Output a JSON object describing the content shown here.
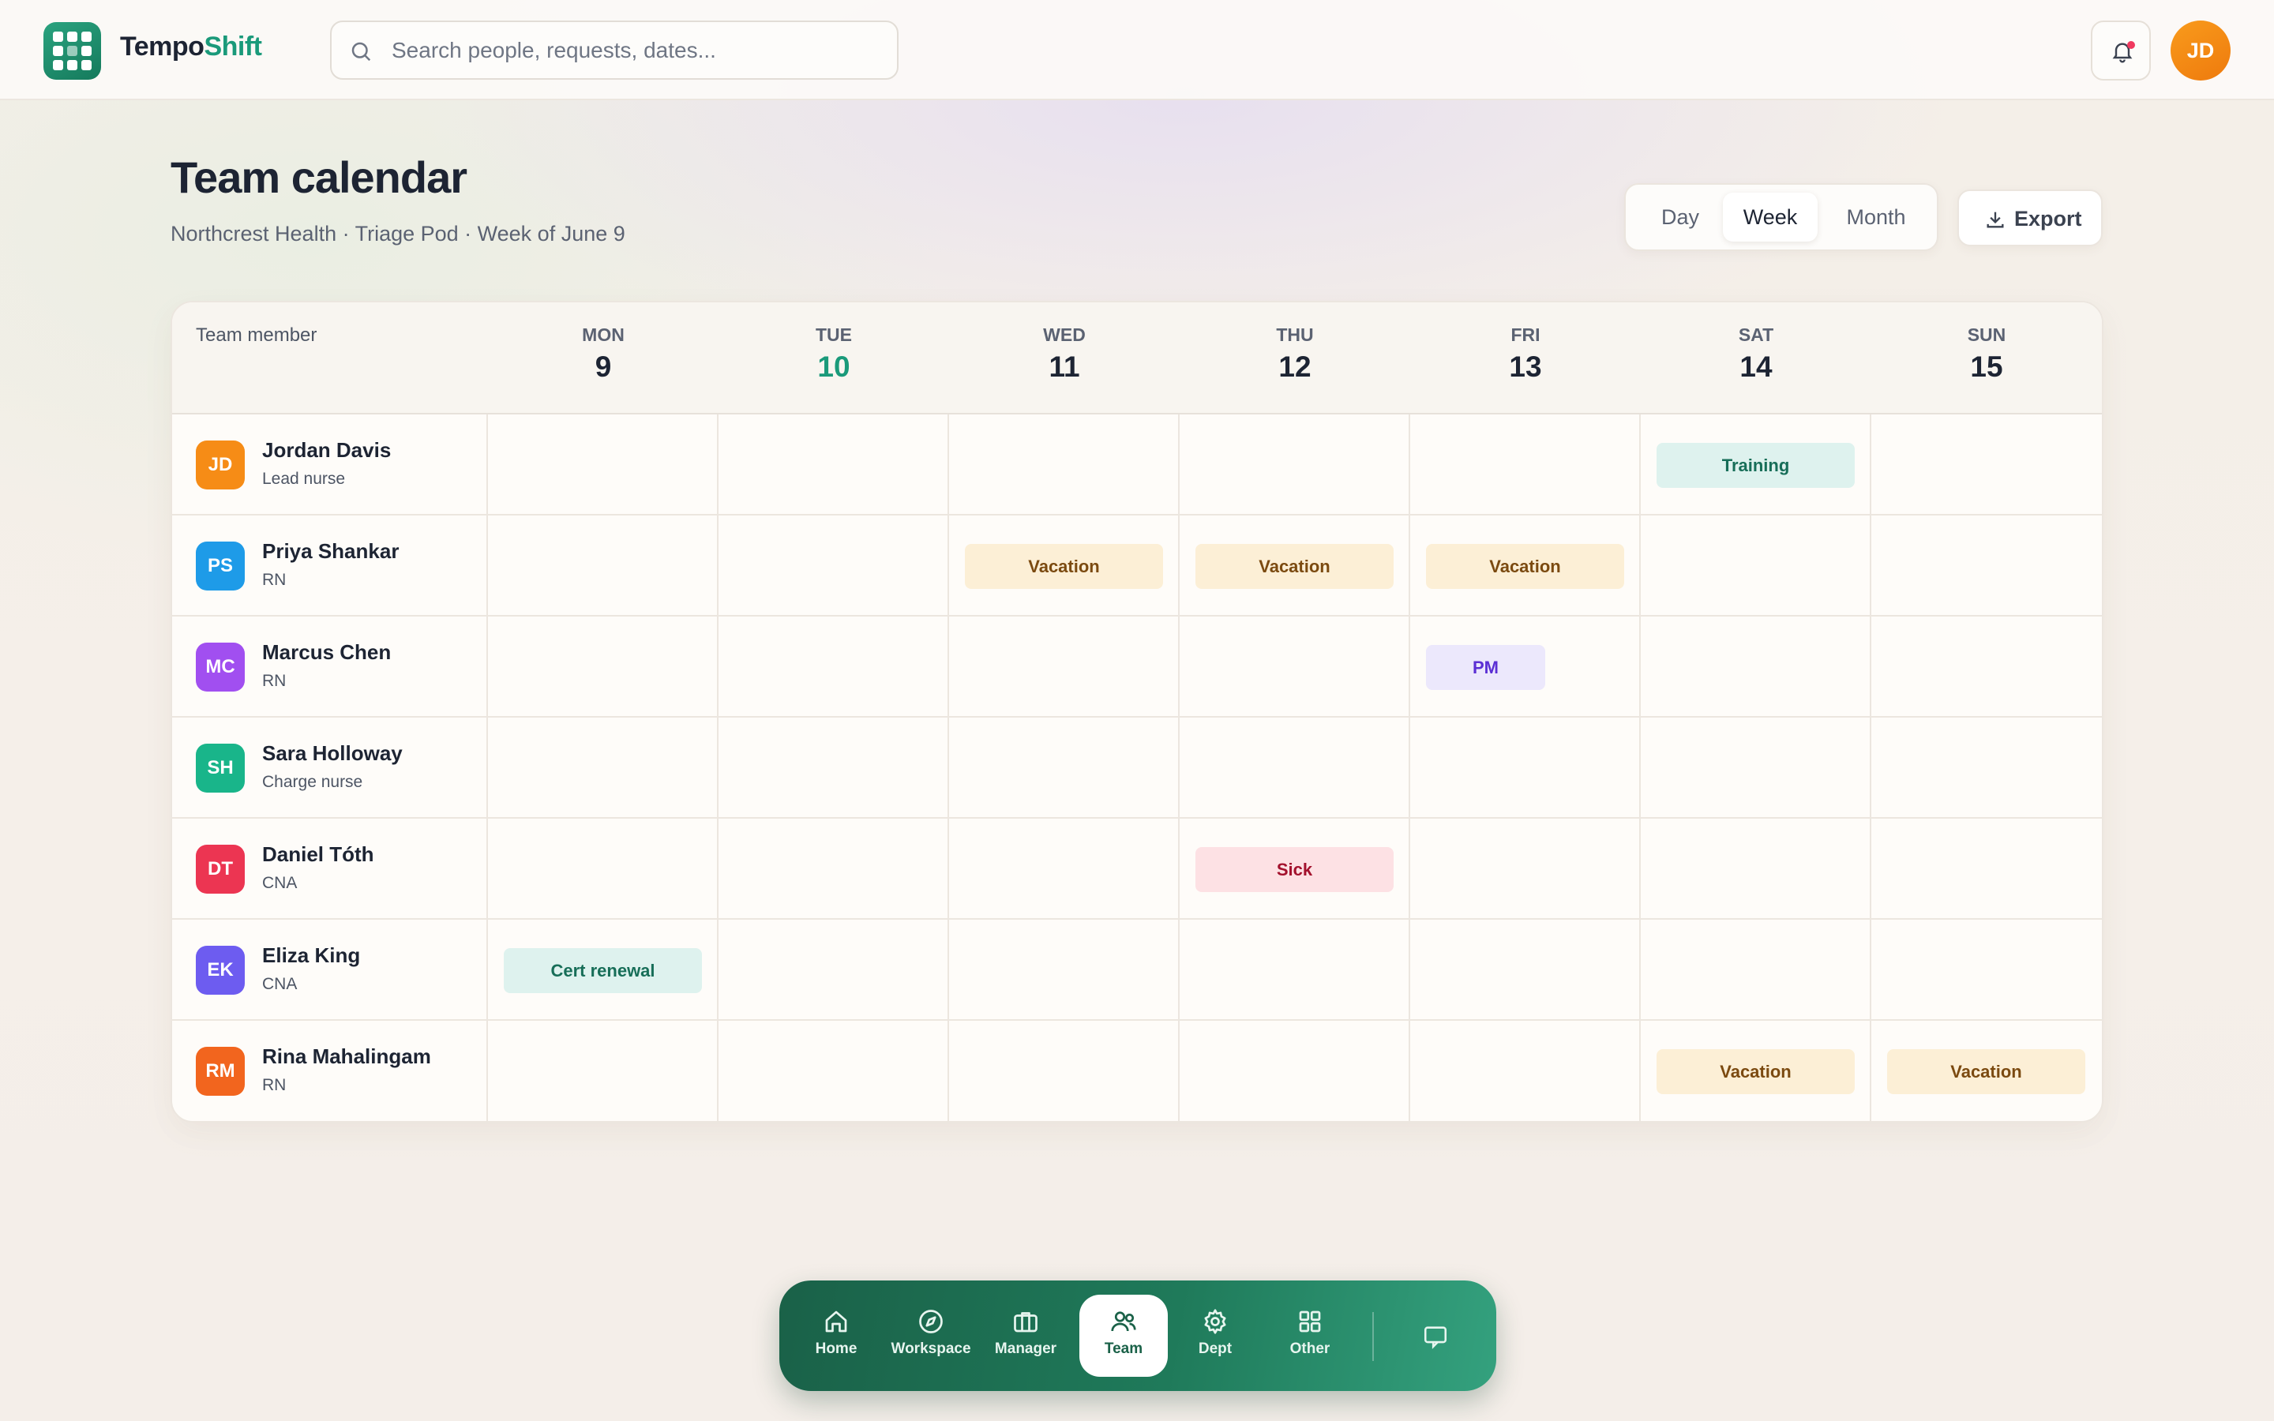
{
  "app": {
    "brand_part1": "Tempo",
    "brand_part2": "Shift",
    "user_initials": "JD",
    "accent_color": "#1a9a7a"
  },
  "search": {
    "placeholder": "Search people, requests, dates..."
  },
  "header": {
    "title": "Team calendar",
    "subtitle": "Northcrest Health · Triage Pod · Week of June 9"
  },
  "view_toggle": {
    "options": [
      "Day",
      "Week",
      "Month"
    ],
    "selected": "Week"
  },
  "export_label": "Export",
  "calendar": {
    "member_column_label": "Team member",
    "days": [
      {
        "name": "MON",
        "num": "9"
      },
      {
        "name": "TUE",
        "num": "10",
        "today": true
      },
      {
        "name": "WED",
        "num": "11"
      },
      {
        "name": "THU",
        "num": "12"
      },
      {
        "name": "FRI",
        "num": "13"
      },
      {
        "name": "SAT",
        "num": "14"
      },
      {
        "name": "SUN",
        "num": "15"
      }
    ],
    "members": [
      {
        "initials": "JD",
        "name": "Jordan Davis",
        "role": "Lead nurse",
        "avatar_color": "#f68c16",
        "events": {
          "SAT": "Training"
        }
      },
      {
        "initials": "PS",
        "name": "Priya Shankar",
        "role": "RN",
        "avatar_color": "#1e9be8",
        "events": {
          "WED": "Vacation",
          "THU": "Vacation",
          "FRI": "Vacation"
        }
      },
      {
        "initials": "MC",
        "name": "Marcus Chen",
        "role": "RN",
        "avatar_color": "#a14ff0",
        "events": {
          "FRI": "PM"
        }
      },
      {
        "initials": "SH",
        "name": "Sara Holloway",
        "role": "Charge nurse",
        "avatar_color": "#19b58a",
        "events": {}
      },
      {
        "initials": "DT",
        "name": "Daniel Tóth",
        "role": "CNA",
        "avatar_color": "#ec3552",
        "events": {
          "THU": "Sick"
        }
      },
      {
        "initials": "EK",
        "name": "Eliza King",
        "role": "CNA",
        "avatar_color": "#6d5cf0",
        "events": {
          "MON": "Cert renewal"
        }
      },
      {
        "initials": "RM",
        "name": "Rina Mahalingam",
        "role": "RN",
        "avatar_color": "#f2651e",
        "events": {
          "SAT": "Vacation",
          "SUN": "Vacation"
        }
      }
    ]
  },
  "dock": {
    "items": [
      {
        "label": "Home",
        "icon": "home-icon"
      },
      {
        "label": "Workspace",
        "icon": "compass-icon"
      },
      {
        "label": "Manager",
        "icon": "briefcase-icon"
      },
      {
        "label": "Team",
        "icon": "users-icon",
        "active": true
      },
      {
        "label": "Dept",
        "icon": "gear-icon"
      },
      {
        "label": "Other",
        "icon": "grid-icon"
      }
    ],
    "chat_icon": "chat-icon"
  }
}
